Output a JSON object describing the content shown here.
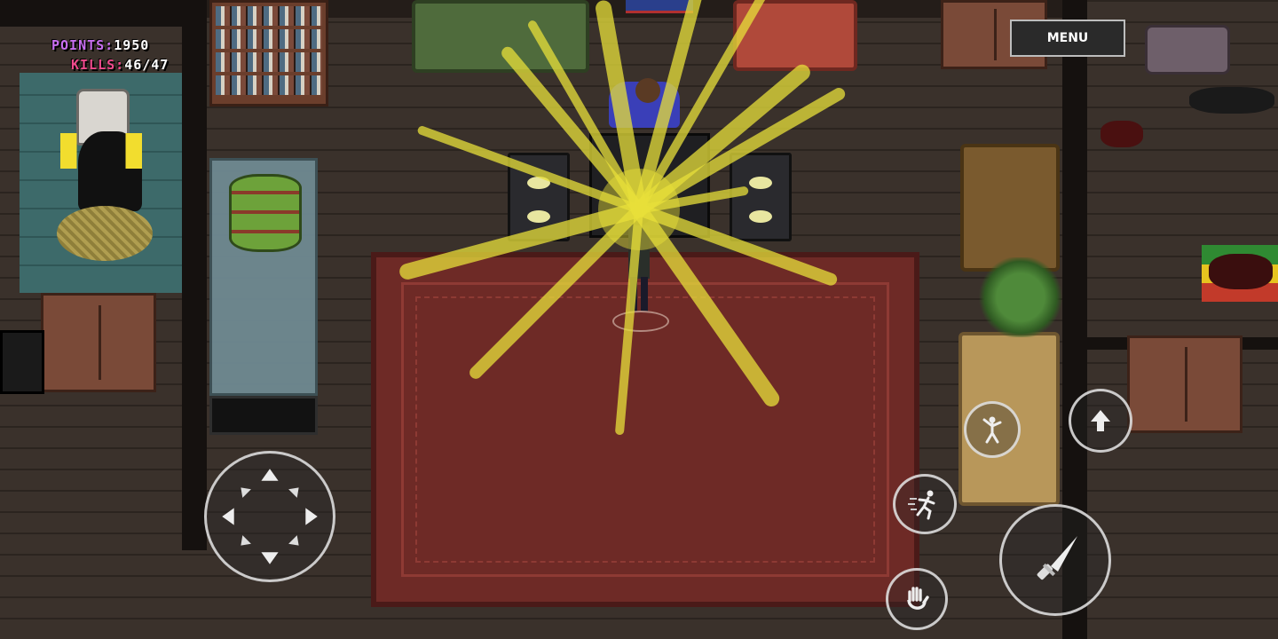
{
  "hud": {
    "points_label": "POINTS:",
    "points_value": "1950",
    "kills_label": "KILLS:",
    "kills_value": "46/47",
    "points_label_color": "#c86ef0",
    "kills_label_color": "#f04a8c",
    "value_color": "#ffffff"
  },
  "menu": {
    "label": "MENU"
  },
  "controls": {
    "dpad": {
      "icon": "dpad-arrows-icon"
    },
    "up_button": {
      "icon": "up-arrow-icon"
    },
    "dance_button": {
      "icon": "dancing-figure-icon"
    },
    "sprint_button": {
      "icon": "running-figure-icon"
    },
    "grab_button": {
      "icon": "hand-icon"
    },
    "attack_button": {
      "icon": "knife-icon"
    }
  },
  "scene": {
    "burst_color": "#e8e03a",
    "rug_color": "#6e2a26",
    "wall_color": "#15110f"
  }
}
